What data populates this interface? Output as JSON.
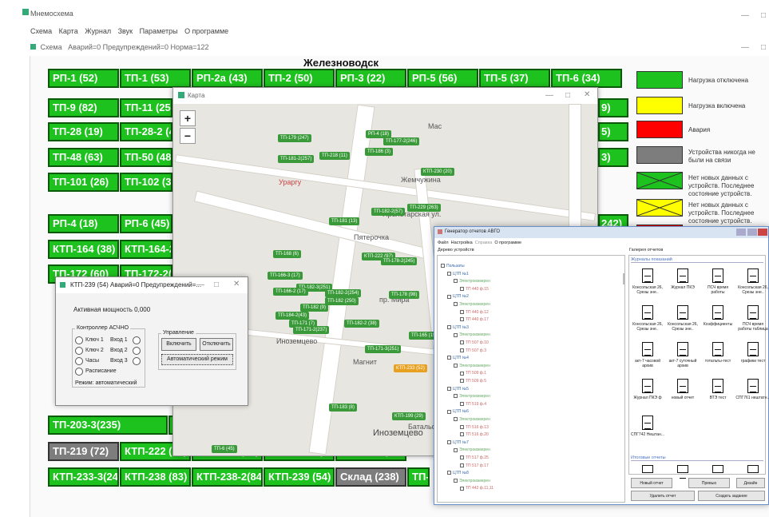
{
  "app": {
    "title": "Мнемосхема",
    "status": "Аварий=0 Предупреждений=0 Норма=122",
    "status_prefix": "Схема"
  },
  "menu": [
    "Схема",
    "Карта",
    "Журнал",
    "Звук",
    "Параметры",
    "О программе"
  ],
  "schema": {
    "title": "Железноводск",
    "tiles": [
      {
        "label": "РП-1 (52)",
        "state": "green"
      },
      {
        "label": "ТП-1 (53)",
        "state": "green"
      },
      {
        "label": "РП-2а (43)",
        "state": "green"
      },
      {
        "label": "ТП-2 (50)",
        "state": "green"
      },
      {
        "label": "РП-3 (22)",
        "state": "green"
      },
      {
        "label": "РП-5 (56)",
        "state": "green"
      },
      {
        "label": "ТП-5 (37)",
        "state": "green"
      },
      {
        "label": "ТП-6 (34)",
        "state": "green"
      },
      {
        "label": "ТП-9 (82)",
        "state": "green"
      },
      {
        "label": "ТП-11 (25)",
        "state": "green"
      },
      {
        "label": "ТП-28 (19)",
        "state": "green"
      },
      {
        "label": "ТП-28-2 (4",
        "state": "green"
      },
      {
        "label": "ТП-48 (63)",
        "state": "green"
      },
      {
        "label": "ТП-50 (48)",
        "state": "green"
      },
      {
        "label": "ТП-101 (26)",
        "state": "green"
      },
      {
        "label": "ТП-102 (32",
        "state": "green"
      },
      {
        "label": "РП-4 (18)",
        "state": "green"
      },
      {
        "label": "РП-6 (45)",
        "state": "green"
      },
      {
        "label": "КТП-164 (38)",
        "state": "green"
      },
      {
        "label": "КТП-164-2(2",
        "state": "green"
      },
      {
        "label": "ТП-172 (60)",
        "state": "green"
      },
      {
        "label": "ТП-172-2(6",
        "state": "green"
      },
      {
        "label": "ТП-203-3(235)",
        "state": "green"
      },
      {
        "label": "ТП-205 (39",
        "state": "green"
      },
      {
        "label": "ТП-219 (72)",
        "state": "gray"
      },
      {
        "label": "КТП-222 (30)",
        "state": "green"
      },
      {
        "label": "КТП-224 (33)",
        "state": "green"
      },
      {
        "label": "КТП-224-2(240)",
        "state": "green"
      },
      {
        "label": "КТП-229 (263)",
        "state": "green"
      },
      {
        "label": "КТП-233-3(245)",
        "state": "green"
      },
      {
        "label": "КТП-238 (83)",
        "state": "green"
      },
      {
        "label": "КТП-238-2(84)",
        "state": "green"
      },
      {
        "label": "КТП-239 (54)",
        "state": "green"
      },
      {
        "label": "Склад (238)",
        "state": "gray"
      },
      {
        "label": "ТП-82",
        "state": "green"
      }
    ],
    "right_partial": [
      "9)",
      "5)",
      "3)",
      "242)"
    ]
  },
  "legend": [
    {
      "label": "Нагрузка отключена",
      "color": "#1ec21e"
    },
    {
      "label": "Нагрузка включена",
      "color": "#ffff00"
    },
    {
      "label": "Авария",
      "color": "#ff0000"
    },
    {
      "label": "Устройства никогда не были на связи",
      "color": "#7d7d7d"
    },
    {
      "label": "Нет новых данных с устройств. Последнее состояние устройств.",
      "color": "#1ec21e"
    },
    {
      "label": "Нет новых данных с устройств. Последнее состояние устройств.",
      "color": "#ffff00"
    }
  ],
  "map": {
    "title": "Карта",
    "zoom_in": "+",
    "zoom_out": "−",
    "labels": [
      "Ураргу",
      "Пролетарская ул.",
      "Пятерочка",
      "Иноземцево",
      "Магнит",
      "Батальонная",
      "Иноземцево",
      "Жемчужина",
      "пр. Мира",
      "Мас"
    ],
    "pins": [
      "ТП-179 (247)",
      "РП-4 (18)",
      "ТП-177-2(246)",
      "ТП-181-2(257)",
      "ТП-218 (11)",
      "ТП-186 (3)",
      "КТП-230 (20)",
      "ТП-182-2(57)",
      "ТП-229 (263)",
      "ТП-181 (13)",
      "КТП-237-2(252)",
      "ТП-168 (6)",
      "КТП-222 (97)",
      "ТП-178-2(245)",
      "ТП-166-3 (17)",
      "ТП-182-3(251)",
      "ТП-166-2 (17)",
      "ТП-182-2(254)",
      "ТП-182 (250)",
      "ТП-178 (98)",
      "ТП-182 (9)",
      "ТП-184-2(43)",
      "ТП-171 (7)",
      "ТП-171-2(237)",
      "ТП-182-2 (38)",
      "ТП-165 (15)",
      "ТП-171-3(251)",
      "КТП-233 (52)",
      "ТП-183 (8)",
      "КТП-199 (29)",
      "ТП-6 (45)",
      "КТП-224 (30)"
    ]
  },
  "ktp": {
    "title": "КТП-239 (54)   Аварий=0 Предупреждений=...",
    "power": "Активная мощность   0,000",
    "controller_group": "Контроллер АСЧНО",
    "keys": [
      "Ключ 1",
      "Ключ 2",
      "Часы",
      "Расписание"
    ],
    "inputs": [
      "Вход 1",
      "Вход 2",
      "Вход 3"
    ],
    "mode": "Режим: автоматический",
    "control_group": "Управление",
    "btn_on": "Включить",
    "btn_off": "Отключить",
    "btn_auto": "Автоматический режим"
  },
  "report": {
    "title": "Генератор отчетов АВГО",
    "menu": [
      "Файл",
      "Настройка",
      "Справка",
      "О программе"
    ],
    "tree_title": "Дерево устройств",
    "gallery_title": "Галерея отчетов",
    "section1": "Журналы показаний",
    "section2": "Итоговые отчеты",
    "tree": [
      "Пользаты",
      "ЦТП №1",
      "Электроизмерен",
      "ТП 440 ф.15",
      "ЦТП №2",
      "Электроизмерен",
      "ТП 440 ф.12",
      "ТП 440 ф.17",
      "ЦТП №3",
      "Электроизмерен",
      "ТП 507 ф.10",
      "ТП 507 ф.3",
      "ЦТП №4",
      "Электроизмерен",
      "ТП 509 ф.1",
      "ТП 509 ф.5",
      "ЦТП №5",
      "Электроизмерен",
      "ТП 519 ф.4",
      "ЦТП №6",
      "Электроизмерен",
      "ТП 516 ф.13",
      "ТП 516 ф.20",
      "ЦТП №7",
      "Электроизмерен",
      "ТП 517 ф.25",
      "ТП 517 ф.17",
      "ЦТП №8",
      "Электроизмерен",
      "ТП 442 ф.11,11"
    ],
    "docs": [
      "Консольская 26, Срезы эне..",
      "Журнал ПКЭ",
      "ПСЧ время работы",
      "Консольская 26, Срезы эне..",
      "Консольская 26, Срезы эне..",
      "Консольская 26, Срезы эне..",
      "Коэффициенты",
      "ПСЧ время работы таблица",
      "акт-7 часовой архив",
      "акт-7 суточный архив",
      "тотальты-тест",
      "графики тест",
      "Журнал ПКЭ ф",
      "новый отчет",
      "ВТЭ тест",
      "СПГ761 нештатн...",
      "СПГ742 Нештан..."
    ],
    "buttons": [
      "Новый отчет",
      "Превью",
      "Дизайн",
      "Удалить отчет",
      "Создать задание"
    ]
  }
}
